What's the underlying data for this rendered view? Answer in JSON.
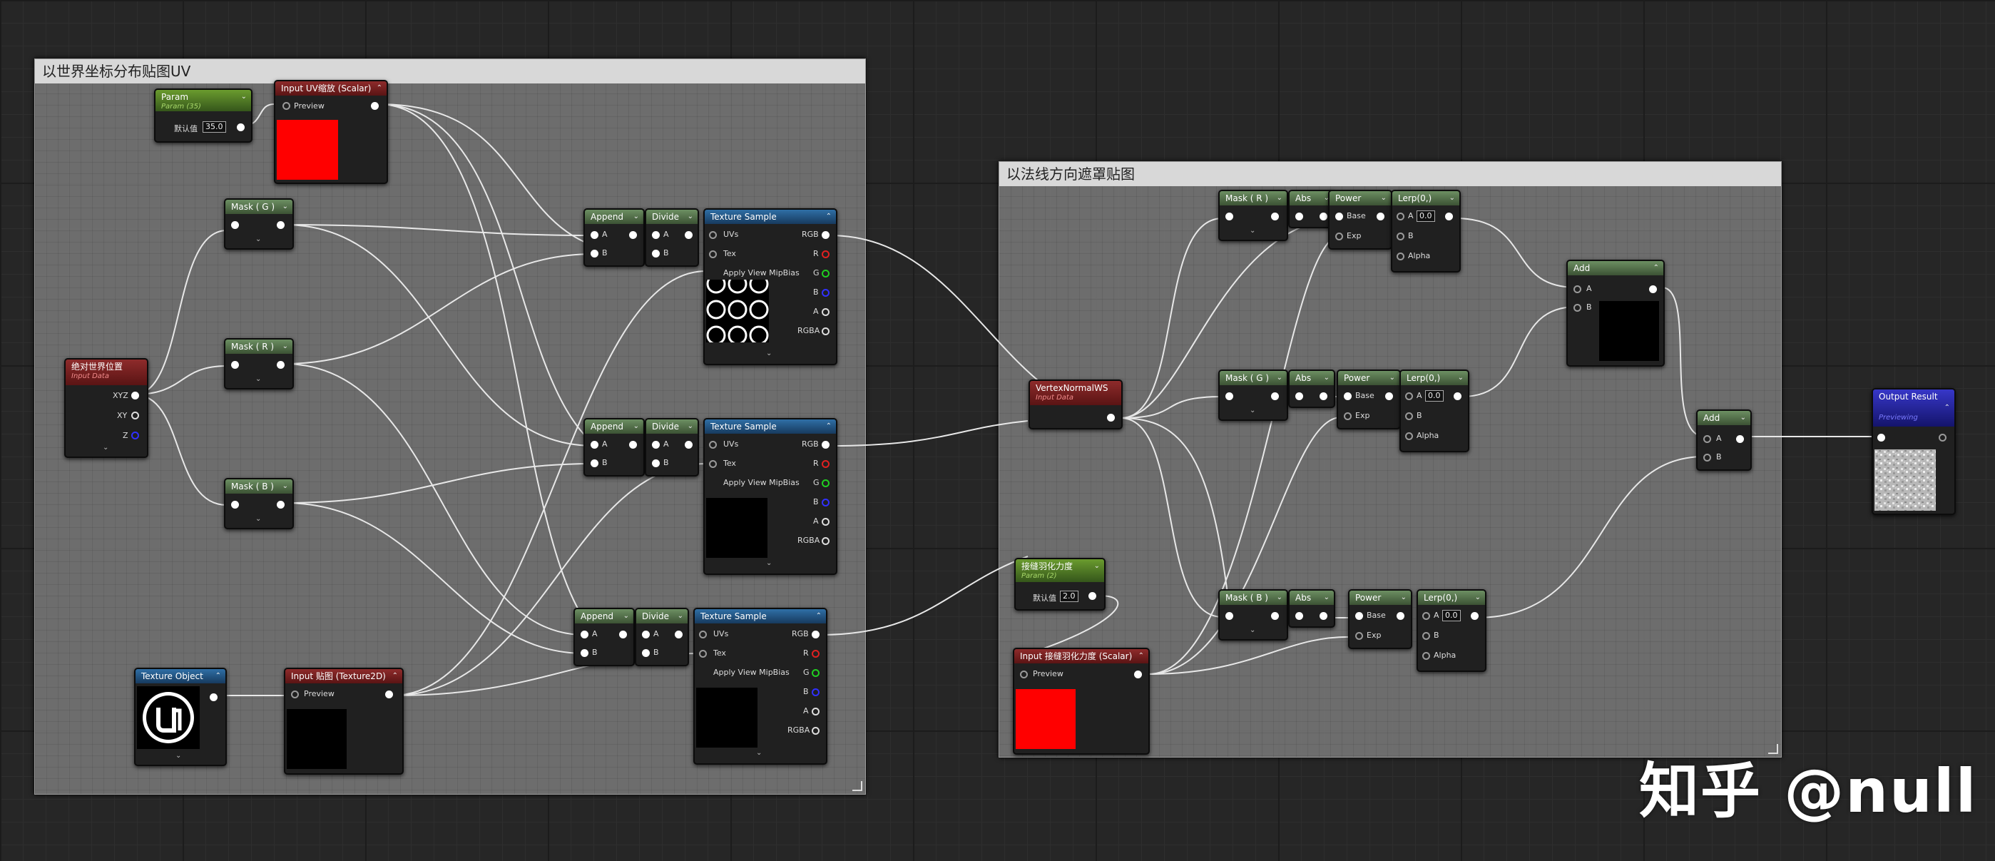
{
  "comments": {
    "uv": "以世界坐标分布贴图UV",
    "normal": "以法线方向遮罩贴图"
  },
  "nodes": {
    "param35": {
      "title": "Param",
      "subtitle": "Param (35)",
      "default_label": "默认值",
      "value": "35.0"
    },
    "input_uv_scale": {
      "title": "Input UV缩放 (Scalar)",
      "preview": "Preview"
    },
    "mask_g1": {
      "title": "Mask ( G )"
    },
    "mask_r1": {
      "title": "Mask ( R )"
    },
    "mask_b1": {
      "title": "Mask ( B )"
    },
    "absolute_world_position": {
      "title": "绝对世界位置",
      "subtitle": "Input Data",
      "pins": [
        "XYZ",
        "XY",
        "Z"
      ]
    },
    "append1": {
      "title": "Append",
      "pins": [
        "A",
        "B"
      ]
    },
    "divide1": {
      "title": "Divide",
      "pins": [
        "A",
        "B"
      ]
    },
    "append2": {
      "title": "Append",
      "pins": [
        "A",
        "B"
      ]
    },
    "divide2": {
      "title": "Divide",
      "pins": [
        "A",
        "B"
      ]
    },
    "append3": {
      "title": "Append",
      "pins": [
        "A",
        "B"
      ]
    },
    "divide3": {
      "title": "Divide",
      "pins": [
        "A",
        "B"
      ]
    },
    "texsample1": {
      "title": "Texture Sample",
      "inputs": [
        "UVs",
        "Tex",
        "Apply View MipBias"
      ],
      "outputs": [
        "RGB",
        "R",
        "G",
        "B",
        "A",
        "RGBA"
      ]
    },
    "texsample2": {
      "title": "Texture Sample",
      "inputs": [
        "UVs",
        "Tex",
        "Apply View MipBias"
      ],
      "outputs": [
        "RGB",
        "R",
        "G",
        "B",
        "A",
        "RGBA"
      ]
    },
    "texsample3": {
      "title": "Texture Sample",
      "inputs": [
        "UVs",
        "Tex",
        "Apply View MipBias"
      ],
      "outputs": [
        "RGB",
        "R",
        "G",
        "B",
        "A",
        "RGBA"
      ]
    },
    "texture_object": {
      "title": "Texture Object"
    },
    "input_texture": {
      "title": "Input 贴图 (Texture2D)",
      "preview": "Preview"
    },
    "vertex_normal": {
      "title": "VertexNormalWS",
      "subtitle": "Input Data"
    },
    "param2": {
      "title": "接缝羽化力度",
      "subtitle": "Param (2)",
      "default_label": "默认值",
      "value": "2.0"
    },
    "input_feather": {
      "title": "Input 接缝羽化力度 (Scalar)",
      "preview": "Preview"
    },
    "mask_r2": {
      "title": "Mask ( R )"
    },
    "mask_g2": {
      "title": "Mask ( G )"
    },
    "mask_b2": {
      "title": "Mask ( B )"
    },
    "abs1": {
      "title": "Abs"
    },
    "abs2": {
      "title": "Abs"
    },
    "abs3": {
      "title": "Abs"
    },
    "power1": {
      "title": "Power",
      "pins": [
        "Base",
        "Exp"
      ]
    },
    "power2": {
      "title": "Power",
      "pins": [
        "Base",
        "Exp"
      ]
    },
    "power3": {
      "title": "Power",
      "pins": [
        "Base",
        "Exp"
      ]
    },
    "lerp1": {
      "title": "Lerp(0,)",
      "pins": [
        "A",
        "B",
        "Alpha"
      ],
      "value": "0.0"
    },
    "lerp2": {
      "title": "Lerp(0,)",
      "pins": [
        "A",
        "B",
        "Alpha"
      ],
      "value": "0.0"
    },
    "lerp3": {
      "title": "Lerp(0,)",
      "pins": [
        "A",
        "B",
        "Alpha"
      ],
      "value": "0.0"
    },
    "add1": {
      "title": "Add",
      "pins": [
        "A",
        "B"
      ]
    },
    "add2": {
      "title": "Add",
      "pins": [
        "A",
        "B"
      ]
    },
    "output": {
      "title": "Output Result",
      "subtitle": "Previewing"
    }
  },
  "colors": {
    "red_preview": "#ff0000",
    "black_preview": "#000000",
    "wire": "#e8e8e8"
  },
  "watermark": "知乎 @null"
}
